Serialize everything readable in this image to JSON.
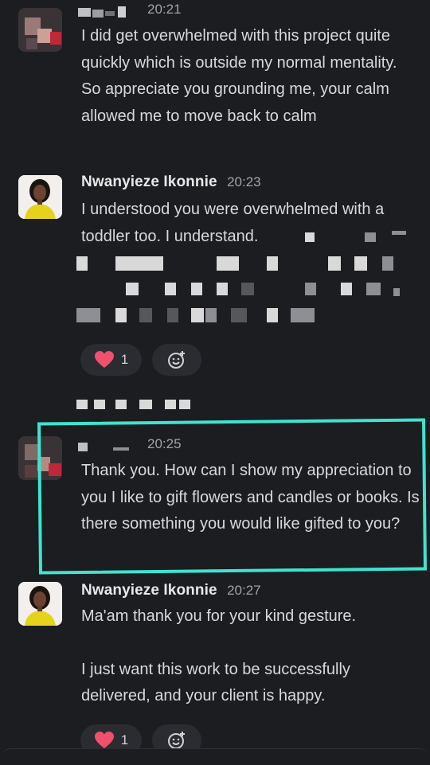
{
  "messages": [
    {
      "sender": "",
      "time": "20:21",
      "lines": [
        "I did get overwhelmed with this project quite quickly which is outside my normal mentality.",
        "So appreciate you grounding me, your calm allowed me to move back to calm"
      ]
    },
    {
      "sender": "Nwanyieze Ikonnie",
      "time": "20:23",
      "lines": [
        "I understood you were overwhelmed with a toddler too. I understand."
      ],
      "reaction": {
        "emoji": "❤",
        "count": "1"
      }
    },
    {
      "sender": "",
      "time": "20:25",
      "lines": [
        "Thank you. How can I show my appreciation to you I like to gift flowers and candles or books. Is there something you would like gifted to you?"
      ]
    },
    {
      "sender": "Nwanyieze Ikonnie",
      "time": "20:27",
      "lines": [
        "Ma'am thank you for your kind gesture.",
        "I just want this work to be successfully delivered, and your client is happy."
      ],
      "reaction": {
        "emoji": "❤",
        "count": "1"
      }
    }
  ],
  "colors": {
    "background": "#1b1d21",
    "highlight": "#3ee4cf",
    "heart": "#f0506e"
  },
  "icons": [
    "heart-emoji",
    "add-reaction-icon"
  ]
}
